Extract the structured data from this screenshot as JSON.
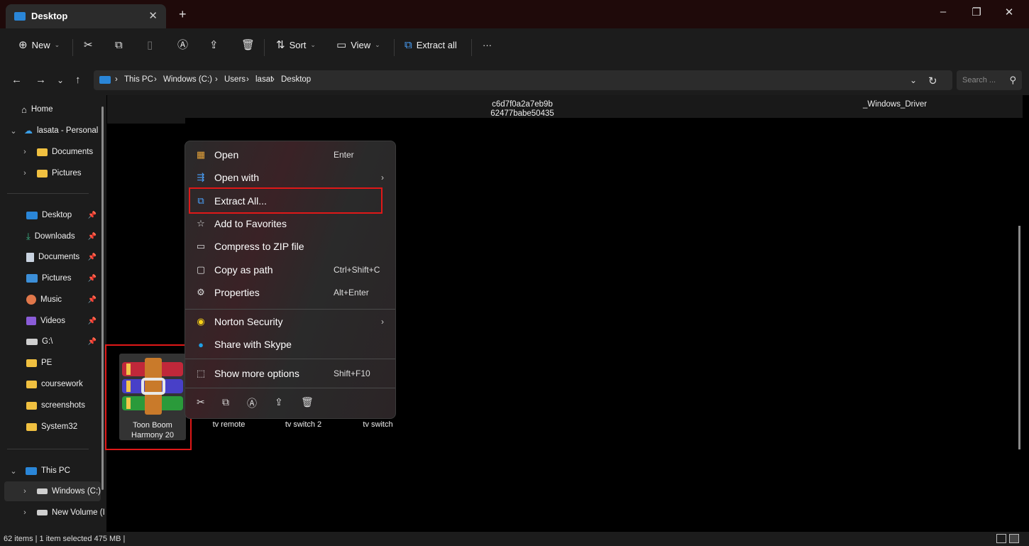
{
  "window": {
    "tab_title": "Desktop",
    "tab_close": "✕",
    "new_tab": "+",
    "minimize": "–",
    "restore": "❐",
    "close": "✕"
  },
  "toolbar": {
    "new_label": "New",
    "sort_label": "Sort",
    "view_label": "View",
    "extract_all_label": "Extract all",
    "more_label": "···"
  },
  "address": {
    "crumbs": [
      "This PC",
      "Windows (C:)",
      "Users",
      "lasat",
      "Desktop"
    ],
    "search_placeholder": "Search ..."
  },
  "sidebar": {
    "home": "Home",
    "onedrive": "lasata - Personal",
    "od_documents": "Documents",
    "od_pictures": "Pictures",
    "quick": [
      "Desktop",
      "Downloads",
      "Documents",
      "Pictures",
      "Music",
      "Videos",
      "G:\\",
      "PE",
      "coursework",
      "screenshots",
      "System32"
    ],
    "this_pc": "This PC",
    "windows_c": "Windows (C:)",
    "new_volume": "New Volume (I"
  },
  "content": {
    "top_label_1": "c6d7f0a2a7eb9b",
    "top_label_2": "62477babe50435",
    "top_label_3": "_Windows_Driver",
    "selected_file_line1": "Toon Boom",
    "selected_file_line2": "Harmony 20",
    "file_tv_remote": "tv remote",
    "file_tv_switch2": "tv switch 2",
    "file_tv_switch": "tv switch"
  },
  "context_menu": {
    "open": "Open",
    "open_shortcut": "Enter",
    "open_with": "Open with",
    "extract_all": "Extract All...",
    "add_favorites": "Add to Favorites",
    "compress_zip": "Compress to ZIP file",
    "copy_path": "Copy as path",
    "copy_path_shortcut": "Ctrl+Shift+C",
    "properties": "Properties",
    "properties_shortcut": "Alt+Enter",
    "norton": "Norton Security",
    "skype": "Share with Skype",
    "more_options": "Show more options",
    "more_options_shortcut": "Shift+F10"
  },
  "status": {
    "text": "62 items  |  1 item selected  475 MB  |"
  },
  "colors": {
    "accent_blue": "#2a86d8",
    "folder_yellow": "#f0c040",
    "highlight_red": "#e01818"
  }
}
